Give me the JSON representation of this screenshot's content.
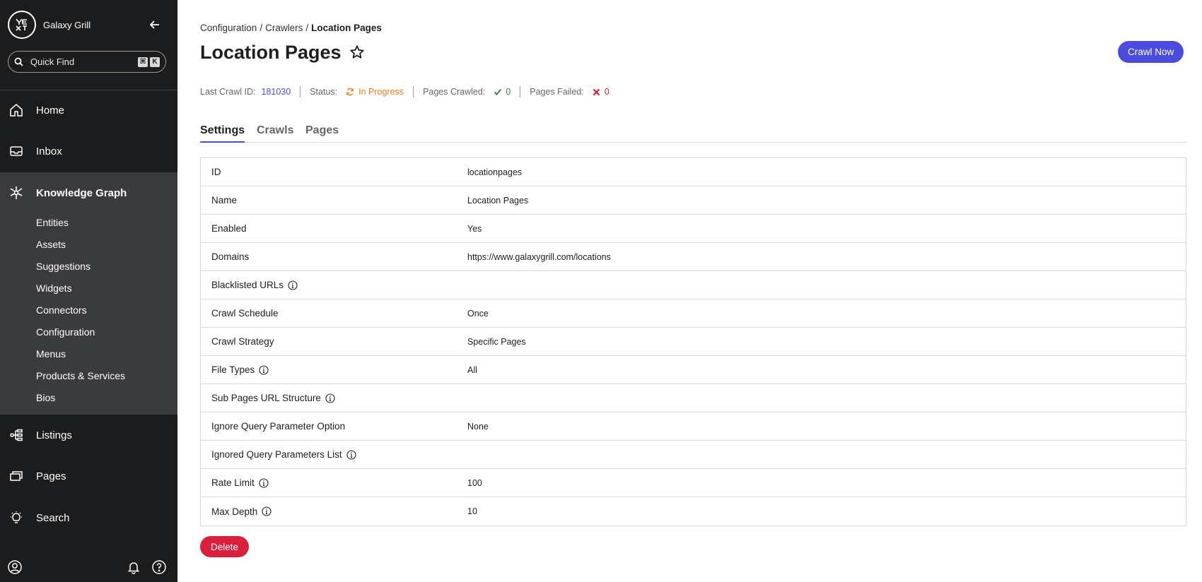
{
  "sidebar": {
    "brand_name": "Galaxy Grill",
    "logo_text": "yext",
    "quick_find": {
      "placeholder": "Quick Find",
      "shortcut_keys": [
        "⌘",
        "K"
      ]
    },
    "nav": {
      "home": "Home",
      "inbox": "Inbox",
      "knowledge_graph": "Knowledge Graph",
      "listings": "Listings",
      "pages": "Pages",
      "search": "Search"
    },
    "kg_items": [
      "Entities",
      "Assets",
      "Suggestions",
      "Widgets",
      "Connectors",
      "Configuration",
      "Menus",
      "Products & Services",
      "Bios"
    ]
  },
  "breadcrumb": {
    "items": [
      "Configuration",
      "Crawlers"
    ],
    "current": "Location Pages"
  },
  "page": {
    "title": "Location Pages",
    "crawl_now_label": "Crawl Now",
    "delete_label": "Delete"
  },
  "status": {
    "last_crawl_id_label": "Last Crawl ID:",
    "last_crawl_id": "181030",
    "status_label": "Status:",
    "status_value": "In Progress",
    "pages_crawled_label": "Pages Crawled:",
    "pages_crawled": "0",
    "pages_failed_label": "Pages Failed:",
    "pages_failed": "0"
  },
  "tabs": [
    "Settings",
    "Crawls",
    "Pages"
  ],
  "settings": [
    {
      "key": "ID",
      "value": "locationpages",
      "info": false
    },
    {
      "key": "Name",
      "value": "Location Pages",
      "info": false
    },
    {
      "key": "Enabled",
      "value": "Yes",
      "info": false
    },
    {
      "key": "Domains",
      "value": "https://www.galaxygrill.com/locations",
      "info": false
    },
    {
      "key": "Blacklisted URLs",
      "value": "",
      "info": true
    },
    {
      "key": "Crawl Schedule",
      "value": "Once",
      "info": false
    },
    {
      "key": "Crawl Strategy",
      "value": "Specific Pages",
      "info": false
    },
    {
      "key": "File Types",
      "value": "All",
      "info": true
    },
    {
      "key": "Sub Pages URL Structure",
      "value": "",
      "info": true
    },
    {
      "key": "Ignore Query Parameter Option",
      "value": "None",
      "info": false
    },
    {
      "key": "Ignored Query Parameters List",
      "value": "",
      "info": true
    },
    {
      "key": "Rate Limit",
      "value": "100",
      "info": true
    },
    {
      "key": "Max Depth",
      "value": "10",
      "info": true
    }
  ],
  "colors": {
    "accent": "#4b4cdf",
    "danger": "#d91f3c",
    "sidebar_bg": "#1b1c1e",
    "sidebar_group_bg": "#3a3b3e",
    "progress": "#f07c19",
    "success": "#2d8a3a"
  }
}
